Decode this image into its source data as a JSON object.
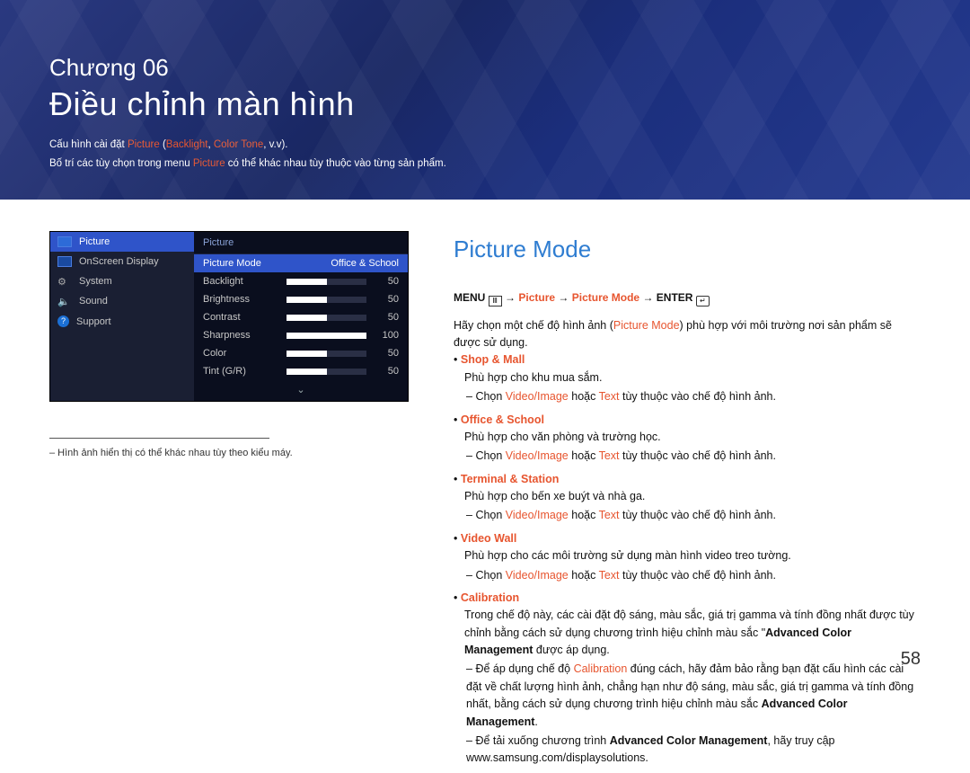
{
  "banner": {
    "chapter": "Chương 06",
    "title": "Điều chỉnh màn hình",
    "desc1_pre": "Cấu hình cài đặt ",
    "desc1_t1": "Picture",
    "desc1_mid": " (",
    "desc1_t2": "Backlight",
    "desc1_sep": ", ",
    "desc1_t3": "Color Tone",
    "desc1_end": ", v.v).",
    "desc2_pre": "Bố trí các tùy chọn trong menu ",
    "desc2_t": "Picture",
    "desc2_end": " có thể khác nhau tùy thuộc vào từng sản phẩm."
  },
  "osd": {
    "menu": [
      {
        "label": "Picture"
      },
      {
        "label": "OnScreen Display"
      },
      {
        "label": "System"
      },
      {
        "label": "Sound"
      },
      {
        "label": "Support"
      }
    ],
    "header": "Picture",
    "mode_label": "Picture Mode",
    "mode_value": "Office & School",
    "rows": [
      {
        "label": "Backlight",
        "value": "50",
        "pct": 50
      },
      {
        "label": "Brightness",
        "value": "50",
        "pct": 50
      },
      {
        "label": "Contrast",
        "value": "50",
        "pct": 50
      },
      {
        "label": "Sharpness",
        "value": "100",
        "pct": 100
      },
      {
        "label": "Color",
        "value": "50",
        "pct": 50
      },
      {
        "label": "Tint (G/R)",
        "value": "50",
        "pct": 50
      }
    ]
  },
  "footnote": "– Hình ảnh hiển thị có thể khác nhau tùy theo kiểu máy.",
  "main": {
    "heading": "Picture Mode",
    "path_menu": "MENU",
    "path_arrow": " → ",
    "path_p1": "Picture",
    "path_p2": "Picture Mode",
    "path_enter": "ENTER",
    "intro_pre": "Hãy chọn một chế độ hình ảnh (",
    "intro_mid": "Picture Mode",
    "intro_post": ") phù hợp với môi trường nơi sản phẩm sẽ được sử dụng.",
    "items": [
      {
        "title": "Shop & Mall",
        "desc": "Phù hợp cho khu mua sắm.",
        "sub_pre": "Chọn ",
        "sub_a": "Video/Image",
        "sub_mid": " hoặc ",
        "sub_b": "Text",
        "sub_post": " tùy thuộc vào chế độ hình ảnh."
      },
      {
        "title": "Office & School",
        "desc": "Phù hợp cho văn phòng và trường học.",
        "sub_pre": "Chọn ",
        "sub_a": "Video/Image",
        "sub_mid": " hoặc ",
        "sub_b": "Text",
        "sub_post": " tùy thuộc vào chế độ hình ảnh."
      },
      {
        "title": "Terminal & Station",
        "desc": "Phù hợp cho bến xe buýt và nhà ga.",
        "sub_pre": "Chọn ",
        "sub_a": "Video/Image",
        "sub_mid": " hoặc ",
        "sub_b": "Text",
        "sub_post": " tùy thuộc vào chế độ hình ảnh."
      },
      {
        "title": "Video Wall",
        "desc": "Phù hợp cho các môi trường sử dụng màn hình video treo tường.",
        "sub_pre": "Chọn ",
        "sub_a": "Video/Image",
        "sub_mid": " hoặc ",
        "sub_b": "Text",
        "sub_post": " tùy thuộc vào chế độ hình ảnh."
      }
    ],
    "calibration": {
      "title": "Calibration",
      "desc_pre": "Trong chế độ này, các cài đặt độ sáng, màu sắc, giá trị gamma và tính đồng nhất được tùy chỉnh bằng cách sử dụng chương trình hiệu chỉnh màu sắc \"",
      "desc_bold": "Advanced Color Management",
      "desc_post": " được áp dụng.",
      "sub1_pre": "Để áp dụng chế độ ",
      "sub1_cal": "Calibration",
      "sub1_mid": " đúng cách, hãy đảm bảo rằng bạn đặt cấu hình các cài đặt về chất lượng hình ảnh, chẳng hạn như độ sáng, màu sắc, giá trị gamma và tính đồng nhất, bằng cách sử dụng chương trình hiệu chỉnh màu sắc ",
      "sub1_bold": "Advanced Color Management",
      "sub1_end": ".",
      "sub2_pre": "Để tải xuống chương trình ",
      "sub2_bold": "Advanced Color Management",
      "sub2_mid": ", hãy truy cập www.samsung.com/displaysolutions."
    }
  },
  "page_number": "58"
}
